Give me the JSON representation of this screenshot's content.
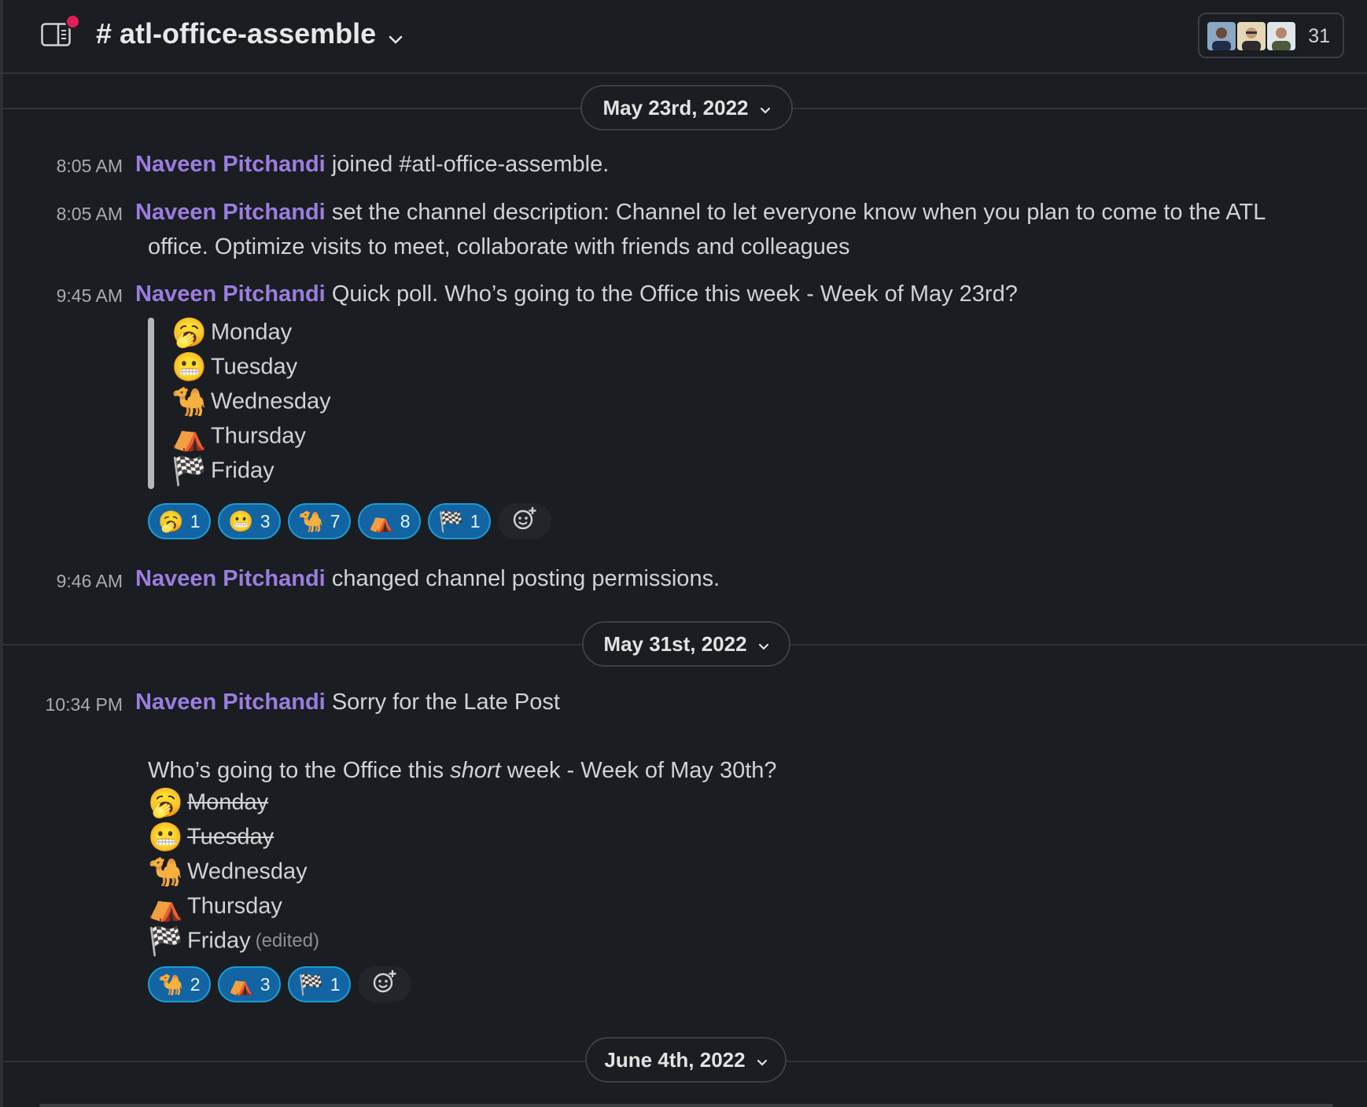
{
  "header": {
    "channel_name": "# atl-office-assemble",
    "member_count": "31",
    "notification_color": "#e01e5a"
  },
  "icons": {
    "sidebar_toggle": "panel-icon",
    "dropdown": "chevron-down-icon",
    "add_reaction": "add-reaction-icon"
  },
  "dates": [
    "May 23rd, 2022",
    "May 31st, 2022",
    "June 4th, 2022"
  ],
  "messages": [
    {
      "time": "8:05 AM",
      "author": "Naveen Pitchandi",
      "text": "joined #atl-office-assemble."
    },
    {
      "time": "8:05 AM",
      "author": "Naveen Pitchandi",
      "text": "set the channel description: Channel to let everyone know when you plan to come to the ATL",
      "text2": "office. Optimize visits to meet, collaborate with friends and colleagues"
    },
    {
      "time": "9:45 AM",
      "author": "Naveen Pitchandi",
      "text": "Quick poll. Who’s going to the Office this week - Week of May 23rd?",
      "options": [
        {
          "emoji": "🥱",
          "label": "Monday"
        },
        {
          "emoji": "😬",
          "label": "Tuesday"
        },
        {
          "emoji": "🐪",
          "label": "Wednesday"
        },
        {
          "emoji": "⛺",
          "label": "Thursday"
        },
        {
          "emoji": "🏁",
          "label": "Friday"
        }
      ],
      "reactions": [
        {
          "emoji": "🥱",
          "count": "1"
        },
        {
          "emoji": "😬",
          "count": "3"
        },
        {
          "emoji": "🐪",
          "count": "7"
        },
        {
          "emoji": "⛺",
          "count": "8"
        },
        {
          "emoji": "🏁",
          "count": "1"
        }
      ]
    },
    {
      "time": "9:46 AM",
      "author": "Naveen Pitchandi",
      "text": "changed channel posting permissions."
    },
    {
      "time": "10:34 PM",
      "author": "Naveen Pitchandi",
      "text": "Sorry for the Late Post",
      "question_pre": "Who’s going to the Office this ",
      "question_em": "short",
      "question_post": " week - Week of May 30th?",
      "options": [
        {
          "emoji": "🥱",
          "label": "Monday",
          "struck": true
        },
        {
          "emoji": "😬",
          "label": "Tuesday",
          "struck": true
        },
        {
          "emoji": "🐪",
          "label": "Wednesday"
        },
        {
          "emoji": "⛺",
          "label": "Thursday"
        },
        {
          "emoji": "🏁",
          "label": "Friday"
        }
      ],
      "edited_label": "(edited)",
      "reactions": [
        {
          "emoji": "🐪",
          "count": "2"
        },
        {
          "emoji": "⛺",
          "count": "3"
        },
        {
          "emoji": "🏁",
          "count": "1"
        }
      ]
    }
  ]
}
